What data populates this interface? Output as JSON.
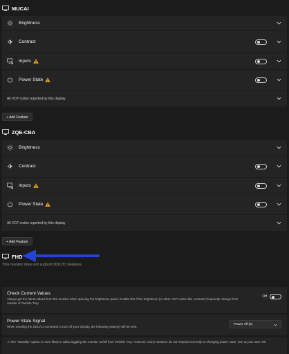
{
  "monitors": [
    {
      "name": "MUCAI",
      "features": [
        {
          "label": "Brightness",
          "icon": "sun-icon",
          "warning": false,
          "toggle": false
        },
        {
          "label": "Contrast",
          "icon": "contrast-icon",
          "warning": false,
          "toggle": true
        },
        {
          "label": "Inputs",
          "icon": "input-icon",
          "warning": true,
          "toggle": true
        },
        {
          "label": "Power State",
          "icon": "power-icon",
          "warning": true,
          "toggle": true
        }
      ],
      "vcp_label": "All VCP codes reported by this display",
      "add_feature": "+ Add Feature"
    },
    {
      "name": "ZQE-CBA",
      "features": [
        {
          "label": "Brightness",
          "icon": "sun-icon",
          "warning": false,
          "toggle": false
        },
        {
          "label": "Contrast",
          "icon": "contrast-icon",
          "warning": false,
          "toggle": true
        },
        {
          "label": "Inputs",
          "icon": "input-icon",
          "warning": true,
          "toggle": true
        },
        {
          "label": "Power State",
          "icon": "power-icon",
          "warning": true,
          "toggle": true
        }
      ],
      "vcp_label": "All VCP codes reported by this display",
      "add_feature": "+ Add Feature"
    },
    {
      "name": "FHD",
      "message": "This monitor does not support DDC/CI features."
    }
  ],
  "settings": {
    "check_values": {
      "title": "Check Current Values",
      "description": "Always get the latest values from the monitor when opening the brightness panel. Enable this if the brightness (or other VCP codes like contrast) frequently change from outside of Twinkle Tray.",
      "toggle_label": "Off"
    },
    "power_signal": {
      "title": "Power State Signal",
      "description": "When sending the DDC/CI command to turn off your display, the following value(s) will be sent.",
      "selected": "Power off (5)"
    },
    "note": "⚠ The \"Standby\" option is more likely to allow toggling the monitor on/off from Twinkle Tray. However, many monitors do not respond correctly to changing power state. Use at your own risk."
  },
  "colors": {
    "background": "#1b1b1b",
    "row": "#242424",
    "warning": "#f5a623",
    "arrow": "#2443d6"
  }
}
